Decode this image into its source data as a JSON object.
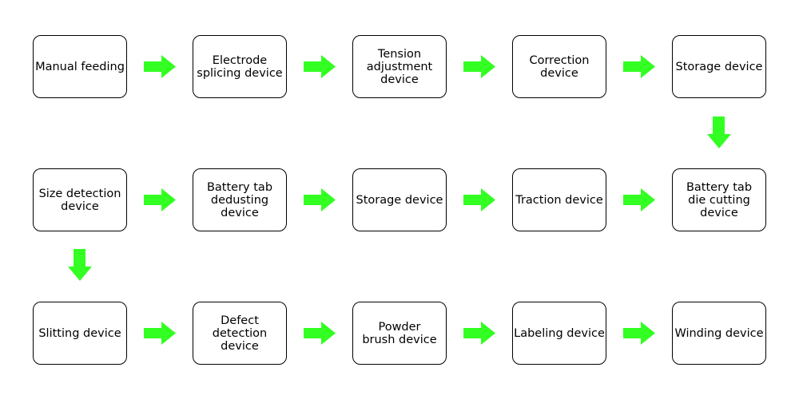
{
  "arrow_color": "#33ff22",
  "flow": {
    "row1": [
      "Manual feeding",
      "Electrode\nsplicing device",
      "Tension\nadjustment\ndevice",
      "Correction\ndevice",
      "Storage device"
    ],
    "row2": [
      "Size detection\ndevice",
      "Battery tab\ndedusting\ndevice",
      "Storage device",
      "Traction device",
      "Battery tab\ndie cutting\ndevice"
    ],
    "row3": [
      "Slitting device",
      "Defect\ndetection device",
      "Powder\nbrush device",
      "Labeling device",
      "Winding device"
    ]
  }
}
